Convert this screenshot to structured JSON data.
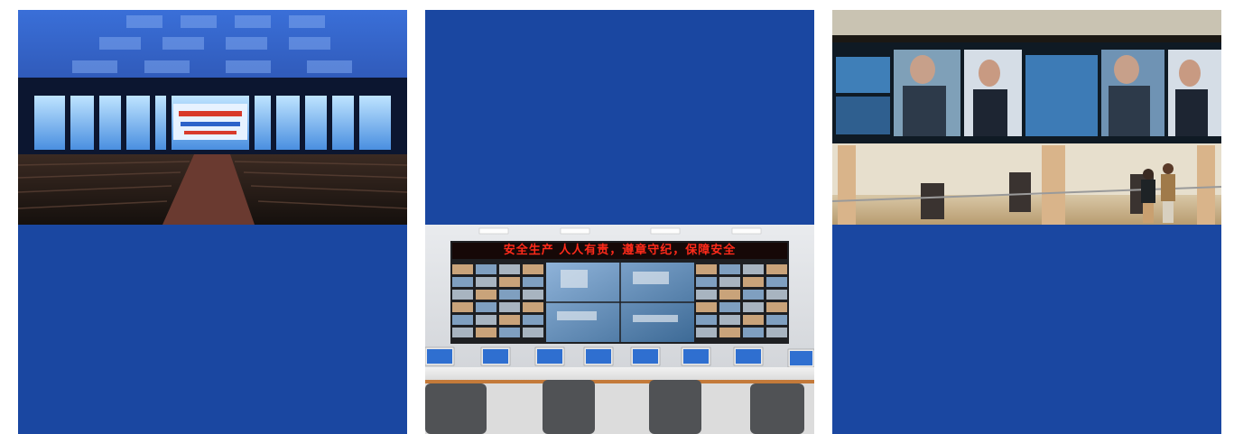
{
  "tiles": [
    {
      "kind": "photo",
      "name": "auditorium-led-stage-photo"
    },
    {
      "kind": "blue-panel",
      "name": "blue-panel-top-center"
    },
    {
      "kind": "photo",
      "name": "lobby-video-wall-photo"
    },
    {
      "kind": "blue-panel",
      "name": "blue-panel-bottom-left"
    },
    {
      "kind": "photo",
      "name": "monitoring-control-room-photo"
    },
    {
      "kind": "blue-panel",
      "name": "blue-panel-bottom-right"
    }
  ],
  "control_room": {
    "banner_text": "安全生产  人人有责，遵章守纪，保障安全"
  },
  "colors": {
    "panel_blue": "#1a47a1",
    "banner_red": "#ff2a1a"
  }
}
